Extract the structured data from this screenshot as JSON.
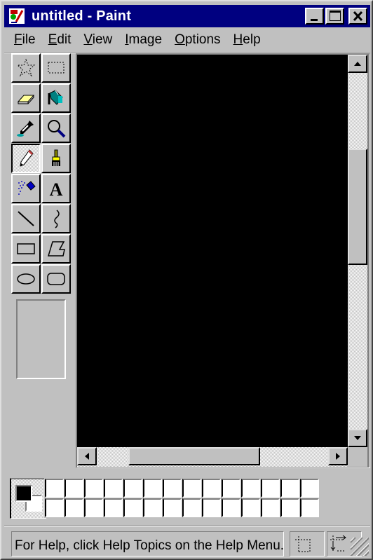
{
  "window": {
    "title": "untitled - Paint",
    "app_icon": "paint-app-icon",
    "controls": {
      "minimize": "minimize-icon",
      "maximize": "maximize-icon",
      "close": "close-icon"
    }
  },
  "menubar": {
    "items": [
      {
        "label": "File",
        "accel": "F",
        "rest": "ile"
      },
      {
        "label": "Edit",
        "accel": "E",
        "rest": "dit"
      },
      {
        "label": "View",
        "accel": "V",
        "rest": "iew"
      },
      {
        "label": "Image",
        "accel": "I",
        "rest": "mage"
      },
      {
        "label": "Options",
        "accel": "O",
        "rest": "ptions"
      },
      {
        "label": "Help",
        "accel": "H",
        "rest": "elp"
      }
    ]
  },
  "toolbox": {
    "tools": [
      {
        "name": "free-form-select",
        "icon": "free-form-select-icon",
        "pressed": false
      },
      {
        "name": "select",
        "icon": "rect-select-icon",
        "pressed": false
      },
      {
        "name": "eraser",
        "icon": "eraser-icon",
        "pressed": false
      },
      {
        "name": "fill-with-color",
        "icon": "paint-bucket-icon",
        "pressed": false
      },
      {
        "name": "pick-color",
        "icon": "eyedropper-icon",
        "pressed": false
      },
      {
        "name": "magnifier",
        "icon": "magnifier-icon",
        "pressed": false
      },
      {
        "name": "pencil",
        "icon": "pencil-icon",
        "pressed": true
      },
      {
        "name": "brush",
        "icon": "brush-icon",
        "pressed": false
      },
      {
        "name": "airbrush",
        "icon": "airbrush-icon",
        "pressed": false
      },
      {
        "name": "text",
        "icon": "text-icon",
        "pressed": false,
        "glyph": "A"
      },
      {
        "name": "line",
        "icon": "line-icon",
        "pressed": false
      },
      {
        "name": "curve",
        "icon": "curve-icon",
        "pressed": false
      },
      {
        "name": "rectangle",
        "icon": "rectangle-icon",
        "pressed": false
      },
      {
        "name": "polygon",
        "icon": "polygon-icon",
        "pressed": false
      },
      {
        "name": "ellipse",
        "icon": "ellipse-icon",
        "pressed": false
      },
      {
        "name": "rounded-rectangle",
        "icon": "rounded-rectangle-icon",
        "pressed": false
      }
    ]
  },
  "canvas": {
    "color": "#000000"
  },
  "colors": {
    "foreground": "#000000",
    "background": "#ffffff",
    "palette_row1": [
      "#ffffff",
      "#ffffff",
      "#ffffff",
      "#ffffff",
      "#ffffff",
      "#ffffff",
      "#ffffff",
      "#ffffff",
      "#ffffff",
      "#ffffff",
      "#ffffff",
      "#ffffff",
      "#ffffff",
      "#ffffff"
    ],
    "palette_row2": [
      "#ffffff",
      "#ffffff",
      "#ffffff",
      "#ffffff",
      "#ffffff",
      "#ffffff",
      "#ffffff",
      "#ffffff",
      "#ffffff",
      "#ffffff",
      "#ffffff",
      "#ffffff",
      "#ffffff",
      "#ffffff"
    ]
  },
  "scrollbars": {
    "vertical": {
      "up": "scroll-up-arrow-icon",
      "down": "scroll-down-arrow-icon"
    },
    "horizontal": {
      "left": "scroll-left-arrow-icon",
      "right": "scroll-right-arrow-icon"
    }
  },
  "statusbar": {
    "message": "For Help, click Help Topics on the Help Menu.",
    "position_icon": "cursor-position-icon",
    "size_icon": "selection-size-icon"
  },
  "accent": {
    "titlebar": "#000080",
    "face": "#c0c0c0"
  }
}
